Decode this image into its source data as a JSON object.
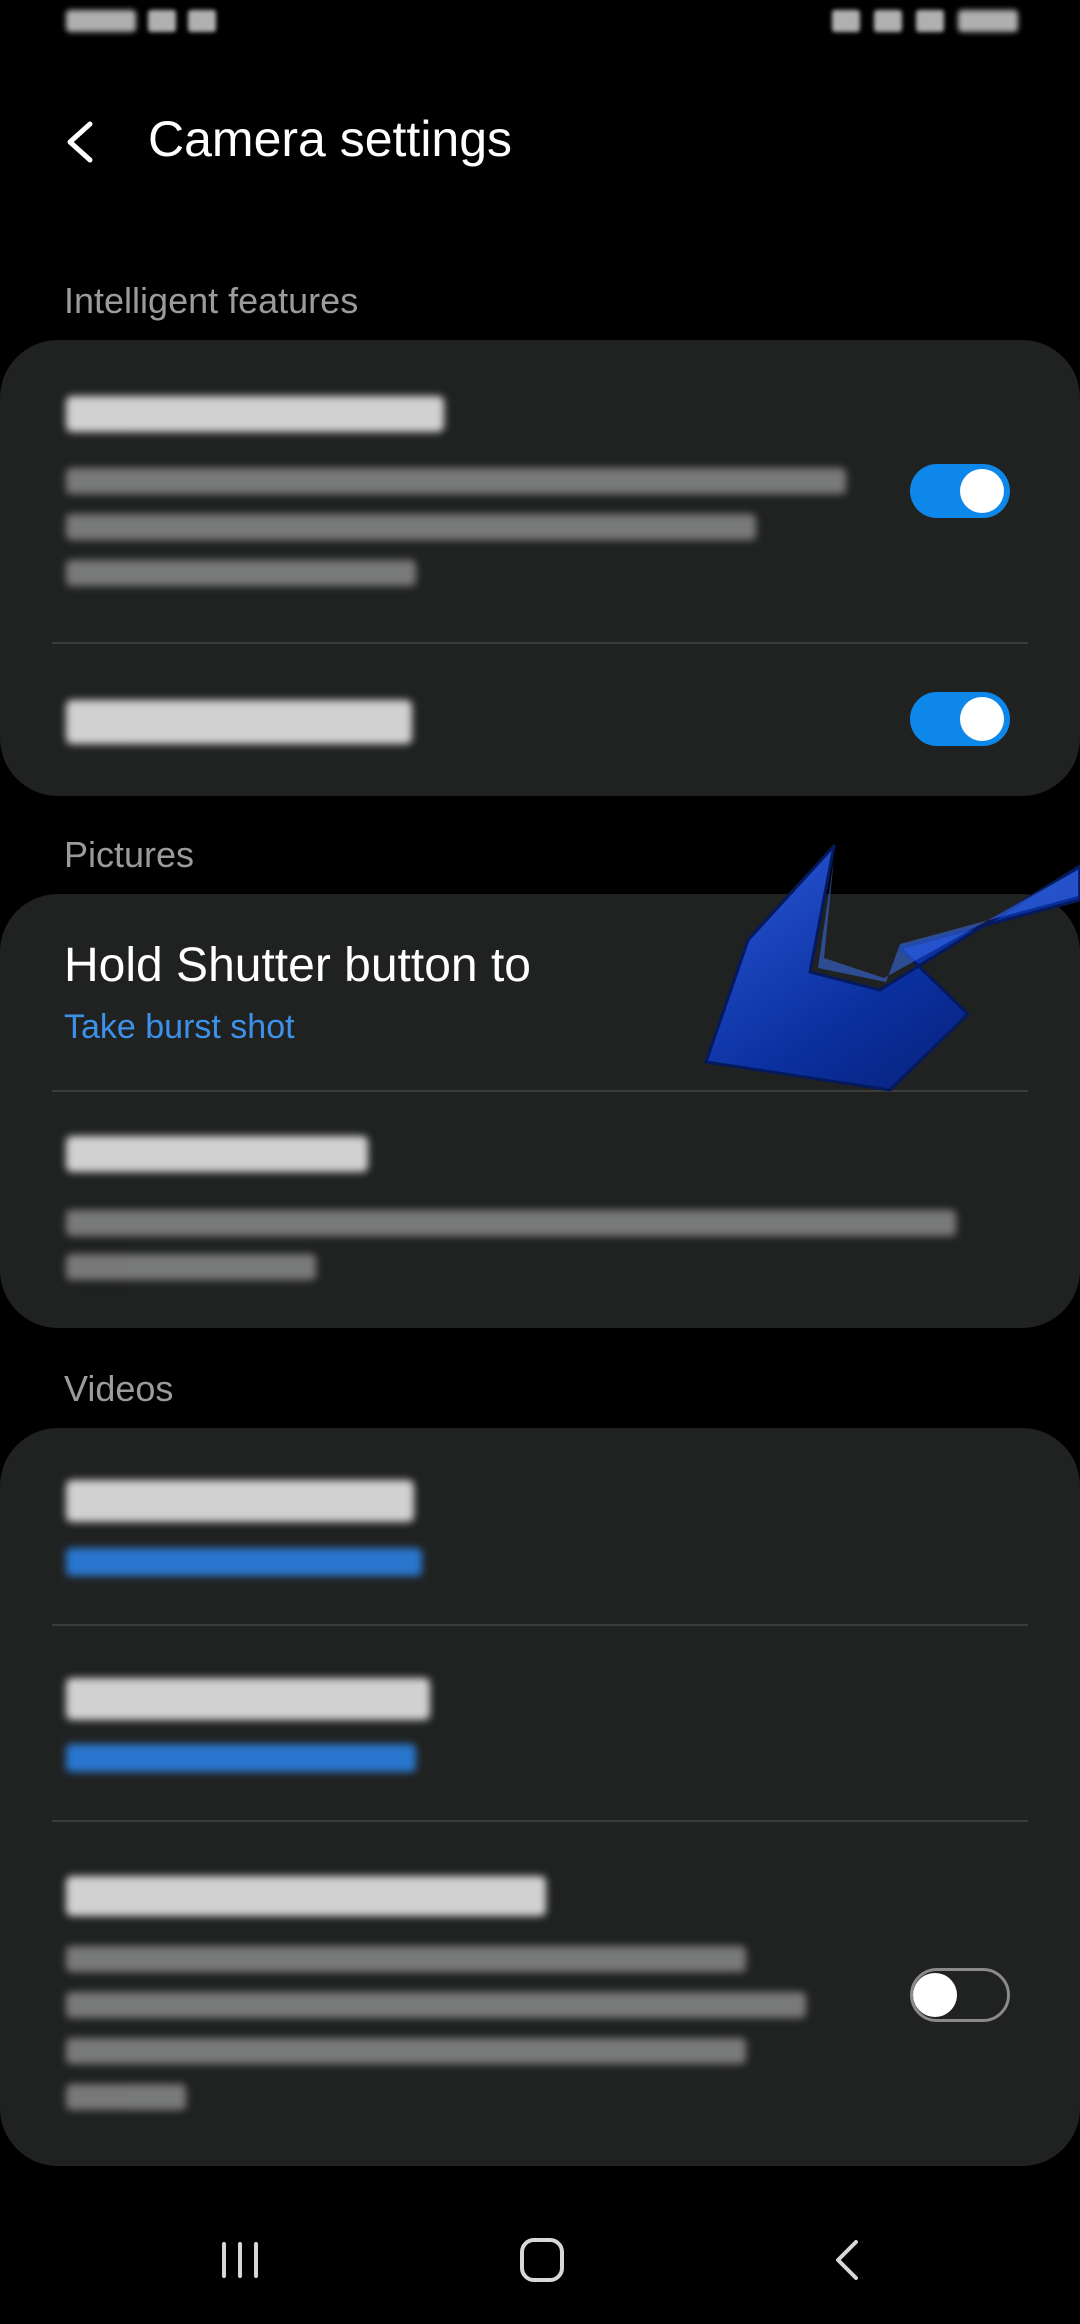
{
  "header": {
    "title": "Camera settings"
  },
  "sections": {
    "intelligent": {
      "label": "Intelligent features"
    },
    "pictures": {
      "label": "Pictures"
    },
    "videos": {
      "label": "Videos"
    }
  },
  "pictures": {
    "hold_shutter": {
      "title": "Hold Shutter button to",
      "value": "Take burst shot"
    }
  },
  "toggles": {
    "scene_optimizer": true,
    "scan_qr": true,
    "high_efficiency_video": false
  },
  "colors": {
    "accent": "#0d87ea",
    "link": "#3e91ea",
    "card": "#202221",
    "annotation_arrow": "#0a2f9e"
  },
  "icons": {
    "back": "chevron-left-icon",
    "recents": "recents-icon",
    "home": "home-icon",
    "nav_back": "nav-back-icon"
  }
}
